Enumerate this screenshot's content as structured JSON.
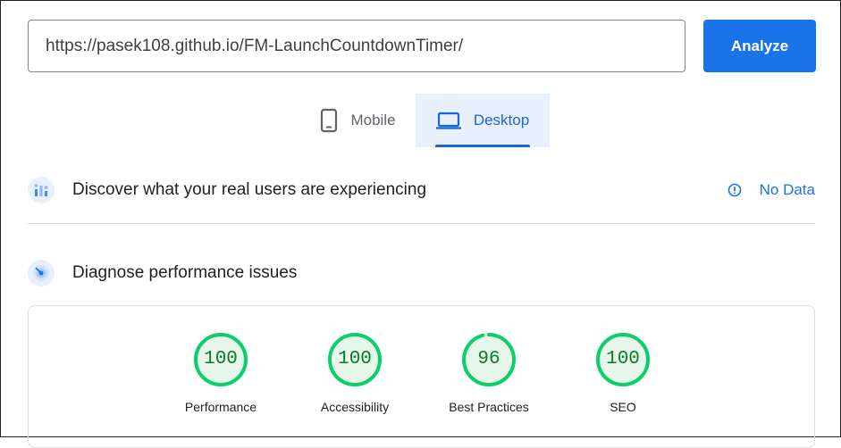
{
  "search": {
    "url_value": "https://pasek108.github.io/FM-LaunchCountdownTimer/",
    "analyze_label": "Analyze"
  },
  "tabs": [
    {
      "label": "Mobile",
      "icon": "smartphone-icon",
      "selected": false
    },
    {
      "label": "Desktop",
      "icon": "laptop-icon",
      "selected": true
    }
  ],
  "field_data": {
    "title": "Discover what your real users are experiencing",
    "status": "No Data",
    "icon": "crux-chart-icon",
    "status_icon": "info-icon"
  },
  "lab_data": {
    "title": "Diagnose performance issues",
    "icon": "lighthouse-target-icon"
  },
  "scores": [
    {
      "label": "Performance",
      "value": "100",
      "fraction": 1.0
    },
    {
      "label": "Accessibility",
      "value": "100",
      "fraction": 1.0
    },
    {
      "label": "Best Practices",
      "value": "96",
      "fraction": 0.96
    },
    {
      "label": "SEO",
      "value": "100",
      "fraction": 1.0
    }
  ],
  "colors": {
    "accent": "#1a73e8",
    "pass_ring": "#0cce6b",
    "pass_fill": "#e6f6ea",
    "pass_text": "#0b7a27"
  }
}
